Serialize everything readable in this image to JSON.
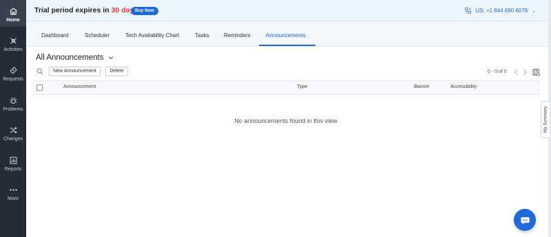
{
  "sidebar": {
    "items": [
      {
        "label": "Home",
        "icon": "home-icon"
      },
      {
        "label": "Activities",
        "icon": "activities-icon"
      },
      {
        "label": "Requests",
        "icon": "requests-icon"
      },
      {
        "label": "Problems",
        "icon": "problems-icon"
      },
      {
        "label": "Changes",
        "icon": "changes-icon"
      },
      {
        "label": "Reports",
        "icon": "reports-icon"
      },
      {
        "label": "More",
        "icon": "more-icon"
      }
    ],
    "active": "Home"
  },
  "banner": {
    "trial_prefix": "Trial period expires in",
    "trial_days": "30 days",
    "buy_label": "Buy Now",
    "phone": "US: +1 844 690 6078"
  },
  "tabs": [
    "Dashboard",
    "Scheduler",
    "Tech Availability Chart",
    "Tasks",
    "Reminders",
    "Announcements"
  ],
  "active_tab": "Announcements",
  "view": {
    "title": "All Announcements",
    "new_button": "New Announcement",
    "delete_button": "Delete",
    "pager": "0 - 0 of 0"
  },
  "table": {
    "columns": [
      "Announcement",
      "Type",
      "Banner",
      "Accessibility"
    ],
    "empty_message": "No announcements found in this view"
  },
  "summary_tab": "My Summary",
  "colors": {
    "accent": "#1f6ad6",
    "sidebar": "#262c36",
    "trial_days": "#e0383e",
    "banner_bg": "#eef6fd"
  }
}
